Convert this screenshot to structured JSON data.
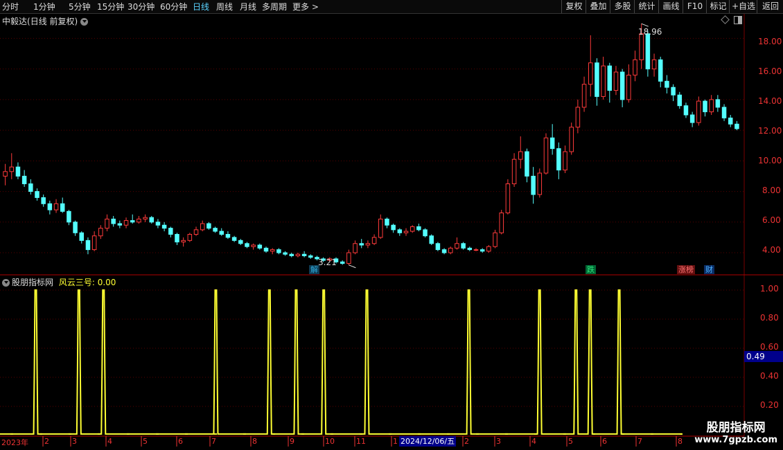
{
  "toolbar": {
    "periods": [
      "分时",
      "1分钟",
      "5分钟",
      "15分钟",
      "30分钟",
      "60分钟",
      "日线",
      "周线",
      "月线",
      "多周期",
      "更多"
    ],
    "active_period": "日线",
    "buttons": [
      "复权",
      "叠加",
      "多股",
      "统计",
      "画线",
      "F10",
      "标记",
      "+自选",
      "返回"
    ]
  },
  "main_panel": {
    "stock_name": "中毅达",
    "mode": "(日线 前复权)",
    "y_axis_labels": [
      "18.00",
      "16.00",
      "14.00",
      "12.00",
      "10.00",
      "8.00",
      "6.00",
      "4.00"
    ],
    "high_label": "18.96",
    "low_label": "3.21",
    "tags": [
      {
        "text": "解",
        "color": "#2ea8d8",
        "bg": "#0e3a52"
      },
      {
        "text": "跌",
        "color": "#2ee07a",
        "bg": "#063"
      },
      {
        "text": "涨榜",
        "color": "#ff7070",
        "bg": "#611"
      },
      {
        "text": "财",
        "color": "#4db2ff",
        "bg": "#0b2e66"
      }
    ]
  },
  "indicator_panel": {
    "name": "股朋指标网",
    "series_label": "风云三号: 0.00",
    "y_axis_labels": [
      "1.00",
      "0.80",
      "0.60",
      "0.40",
      "0.20"
    ],
    "current_value": "0.49"
  },
  "x_axis": {
    "labels": [
      "2023年",
      "2",
      "3",
      "4",
      "5",
      "6",
      "7",
      "8",
      "9",
      "10",
      "11",
      "1",
      "2",
      "3",
      "4",
      "5",
      "6",
      "7",
      "8"
    ],
    "cursor_date": "2024/12/06/五"
  },
  "watermark": {
    "title": "股朋指标网",
    "url": "www.7gpzb.com"
  },
  "colors": {
    "up": "#ff3b3b",
    "down": "#54ffff",
    "indicator": "#ffff33",
    "axis": "#e33",
    "grid": "#5a0000"
  },
  "chart_data": {
    "type": "bar",
    "y_range": [
      2.6,
      19.6
    ],
    "candles": [
      [
        9.0,
        9.8,
        8.4,
        9.3
      ],
      [
        9.3,
        10.5,
        8.8,
        9.6
      ],
      [
        9.6,
        9.9,
        8.8,
        9.0
      ],
      [
        9.0,
        9.4,
        8.3,
        8.5
      ],
      [
        8.5,
        8.8,
        7.8,
        8.0
      ],
      [
        8.0,
        8.2,
        7.4,
        7.6
      ],
      [
        7.6,
        7.8,
        7.0,
        7.2
      ],
      [
        7.2,
        7.4,
        6.5,
        6.8
      ],
      [
        6.8,
        7.5,
        6.6,
        7.2
      ],
      [
        7.2,
        7.6,
        6.6,
        6.7
      ],
      [
        6.7,
        6.8,
        5.8,
        6.0
      ],
      [
        6.0,
        6.1,
        5.1,
        5.3
      ],
      [
        5.3,
        5.4,
        4.6,
        4.8
      ],
      [
        4.8,
        5.0,
        3.9,
        4.2
      ],
      [
        4.2,
        5.4,
        4.1,
        5.1
      ],
      [
        5.1,
        5.8,
        4.9,
        5.6
      ],
      [
        5.6,
        6.5,
        5.4,
        6.2
      ],
      [
        6.2,
        6.4,
        5.7,
        5.9
      ],
      [
        5.9,
        6.1,
        5.6,
        5.8
      ],
      [
        5.8,
        6.3,
        5.6,
        6.1
      ],
      [
        6.1,
        6.5,
        5.9,
        6.0
      ],
      [
        6.0,
        6.4,
        5.9,
        6.2
      ],
      [
        6.2,
        6.5,
        6.0,
        6.3
      ],
      [
        6.3,
        6.4,
        5.9,
        6.0
      ],
      [
        6.0,
        6.2,
        5.6,
        5.8
      ],
      [
        5.8,
        6.0,
        5.4,
        5.6
      ],
      [
        5.6,
        5.7,
        5.0,
        5.2
      ],
      [
        5.2,
        5.3,
        4.5,
        4.7
      ],
      [
        4.7,
        5.0,
        4.4,
        4.8
      ],
      [
        4.8,
        5.3,
        4.7,
        5.2
      ],
      [
        5.2,
        5.7,
        5.1,
        5.5
      ],
      [
        5.5,
        6.1,
        5.4,
        5.9
      ],
      [
        5.9,
        6.0,
        5.5,
        5.6
      ],
      [
        5.6,
        5.7,
        5.3,
        5.4
      ],
      [
        5.4,
        5.6,
        5.1,
        5.2
      ],
      [
        5.2,
        5.4,
        4.9,
        5.0
      ],
      [
        5.0,
        5.1,
        4.7,
        4.8
      ],
      [
        4.8,
        4.9,
        4.5,
        4.6
      ],
      [
        4.6,
        4.7,
        4.3,
        4.4
      ],
      [
        4.4,
        4.6,
        4.2,
        4.5
      ],
      [
        4.5,
        4.6,
        4.2,
        4.3
      ],
      [
        4.3,
        4.4,
        4.0,
        4.1
      ],
      [
        4.1,
        4.3,
        3.9,
        4.2
      ],
      [
        4.2,
        4.3,
        3.9,
        4.0
      ],
      [
        4.0,
        4.1,
        3.8,
        3.9
      ],
      [
        3.9,
        4.0,
        3.7,
        3.8
      ],
      [
        3.8,
        4.0,
        3.7,
        3.9
      ],
      [
        3.9,
        4.1,
        3.7,
        3.8
      ],
      [
        3.8,
        3.9,
        3.6,
        3.7
      ],
      [
        3.7,
        3.8,
        3.5,
        3.6
      ],
      [
        3.6,
        3.7,
        3.4,
        3.5
      ],
      [
        3.5,
        3.7,
        3.4,
        3.6
      ],
      [
        3.6,
        3.7,
        3.3,
        3.4
      ],
      [
        3.4,
        3.5,
        3.21,
        3.3
      ],
      [
        3.3,
        4.2,
        3.2,
        4.0
      ],
      [
        4.0,
        4.8,
        3.9,
        4.6
      ],
      [
        4.6,
        4.9,
        4.3,
        4.5
      ],
      [
        4.5,
        4.8,
        4.3,
        4.6
      ],
      [
        4.6,
        5.2,
        4.5,
        5.0
      ],
      [
        5.0,
        6.5,
        4.9,
        6.2
      ],
      [
        6.2,
        6.3,
        5.6,
        5.8
      ],
      [
        5.8,
        5.9,
        5.3,
        5.5
      ],
      [
        5.5,
        5.6,
        5.1,
        5.3
      ],
      [
        5.3,
        5.6,
        5.1,
        5.4
      ],
      [
        5.4,
        5.8,
        5.3,
        5.7
      ],
      [
        5.7,
        5.9,
        5.4,
        5.5
      ],
      [
        5.5,
        5.6,
        5.0,
        5.1
      ],
      [
        5.1,
        5.2,
        4.5,
        4.6
      ],
      [
        4.6,
        4.7,
        4.1,
        4.2
      ],
      [
        4.2,
        4.3,
        3.9,
        4.0
      ],
      [
        4.0,
        4.4,
        3.9,
        4.3
      ],
      [
        4.3,
        5.0,
        4.2,
        4.6
      ],
      [
        4.6,
        4.7,
        4.2,
        4.3
      ],
      [
        4.3,
        4.4,
        4.1,
        4.2
      ],
      [
        4.2,
        4.3,
        4.1,
        4.2
      ],
      [
        4.2,
        4.3,
        4.0,
        4.1
      ],
      [
        4.1,
        4.5,
        4.0,
        4.4
      ],
      [
        4.4,
        5.5,
        4.3,
        5.3
      ],
      [
        5.3,
        6.8,
        5.2,
        6.6
      ],
      [
        6.6,
        8.8,
        6.5,
        8.5
      ],
      [
        8.5,
        10.5,
        8.3,
        10.1
      ],
      [
        10.1,
        11.6,
        9.5,
        10.6
      ],
      [
        10.6,
        10.8,
        8.6,
        9.0
      ],
      [
        9.0,
        9.6,
        7.2,
        7.8
      ],
      [
        7.8,
        9.5,
        7.6,
        9.2
      ],
      [
        9.2,
        11.8,
        9.1,
        11.5
      ],
      [
        11.5,
        12.4,
        10.4,
        10.8
      ],
      [
        10.8,
        11.2,
        8.8,
        9.4
      ],
      [
        9.4,
        11.0,
        9.2,
        10.6
      ],
      [
        10.6,
        12.5,
        10.4,
        12.2
      ],
      [
        12.2,
        14.0,
        11.8,
        13.5
      ],
      [
        13.5,
        15.5,
        13.2,
        15.0
      ],
      [
        15.0,
        18.2,
        14.2,
        16.4
      ],
      [
        16.4,
        16.7,
        13.6,
        14.2
      ],
      [
        14.2,
        16.8,
        14.0,
        16.2
      ],
      [
        16.2,
        16.4,
        13.8,
        14.6
      ],
      [
        14.6,
        16.2,
        14.3,
        15.8
      ],
      [
        15.8,
        16.0,
        13.5,
        14.0
      ],
      [
        14.0,
        16.3,
        13.8,
        15.6
      ],
      [
        15.6,
        17.2,
        15.2,
        16.6
      ],
      [
        16.6,
        18.96,
        16.0,
        18.3
      ],
      [
        18.3,
        18.5,
        15.5,
        16.0
      ],
      [
        16.0,
        17.0,
        15.5,
        16.6
      ],
      [
        16.6,
        16.8,
        14.8,
        15.2
      ],
      [
        15.2,
        15.6,
        14.4,
        14.8
      ],
      [
        14.8,
        15.0,
        13.9,
        14.3
      ],
      [
        14.3,
        14.5,
        13.4,
        13.6
      ],
      [
        13.6,
        13.8,
        12.8,
        13.0
      ],
      [
        13.0,
        13.2,
        12.2,
        12.5
      ],
      [
        12.5,
        14.2,
        12.3,
        13.9
      ],
      [
        13.9,
        14.0,
        12.9,
        13.2
      ],
      [
        13.2,
        14.3,
        13.0,
        14.0
      ],
      [
        14.0,
        14.3,
        13.2,
        13.5
      ],
      [
        13.5,
        13.7,
        12.6,
        12.8
      ],
      [
        12.8,
        13.0,
        12.2,
        12.4
      ],
      [
        12.4,
        12.6,
        12.0,
        12.1
      ]
    ],
    "indicator": {
      "name": "风云三号",
      "y_range": [
        0,
        1.1
      ],
      "spike_positions": [
        0.048,
        0.106,
        0.139,
        0.29,
        0.362,
        0.398,
        0.435,
        0.493,
        0.63,
        0.725,
        0.774,
        0.793,
        0.832
      ],
      "spike_value": 1.0,
      "baseline": 0.01
    }
  }
}
